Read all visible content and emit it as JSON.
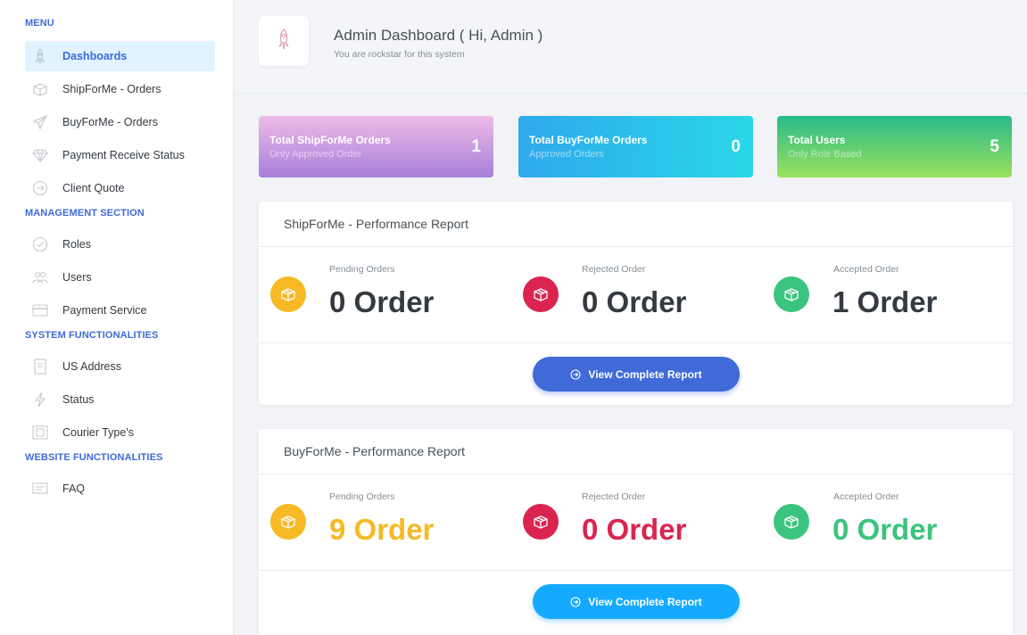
{
  "sidebar": {
    "menu_title": "MENU",
    "menu": [
      {
        "label": "Dashboards",
        "icon": "rocket-icon"
      },
      {
        "label": "ShipForMe - Orders",
        "icon": "box-icon"
      },
      {
        "label": "BuyForMe - Orders",
        "icon": "plane-icon"
      },
      {
        "label": "Payment Receive Status",
        "icon": "diamond-icon"
      },
      {
        "label": "Client Quote",
        "icon": "arrow-circle-icon"
      }
    ],
    "management_title": "MANAGEMENT SECTION",
    "management": [
      {
        "label": "Roles",
        "icon": "check-circle-icon"
      },
      {
        "label": "Users",
        "icon": "users-icon"
      },
      {
        "label": "Payment Service",
        "icon": "credit-card-icon"
      }
    ],
    "system_title": "SYSTEM FUNCTIONALITIES",
    "system": [
      {
        "label": "US Address",
        "icon": "document-icon"
      },
      {
        "label": "Status",
        "icon": "bolt-icon"
      },
      {
        "label": "Courier Type's",
        "icon": "image-icon"
      }
    ],
    "website_title": "WEBSITE FUNCTIONALITIES",
    "website": [
      {
        "label": "FAQ",
        "icon": "comment-icon"
      }
    ]
  },
  "header": {
    "title": "Admin Dashboard ( Hi, Admin )",
    "subtitle": "You are rockstar for this system",
    "icon": "rocket-icon"
  },
  "stats": [
    {
      "title": "Total ShipForMe Orders",
      "subtitle": "Only Approved Order",
      "value": "1"
    },
    {
      "title": "Total BuyForMe Orders",
      "subtitle": "Approved Orders",
      "value": "0"
    },
    {
      "title": "Total Users",
      "subtitle": "Only Role Based",
      "value": "5"
    }
  ],
  "reports": [
    {
      "title": "ShipForMe - Performance Report",
      "widgets": [
        {
          "label": "Pending Orders",
          "value": "0 Order"
        },
        {
          "label": "Rejected Order",
          "value": "0 Order"
        },
        {
          "label": "Accepted Order",
          "value": "1 Order"
        }
      ],
      "button": "View Complete Report"
    },
    {
      "title": "BuyForMe - Performance Report",
      "widgets": [
        {
          "label": "Pending Orders",
          "value": "9 Order"
        },
        {
          "label": "Rejected Order",
          "value": "0 Order"
        },
        {
          "label": "Accepted Order",
          "value": "0 Order"
        }
      ],
      "button": "View Complete Report"
    }
  ],
  "colors": {
    "primary": "#3f6ad8",
    "info": "#16aaff",
    "warning": "#f7b924",
    "danger": "#d92550",
    "success": "#3ac47d"
  }
}
